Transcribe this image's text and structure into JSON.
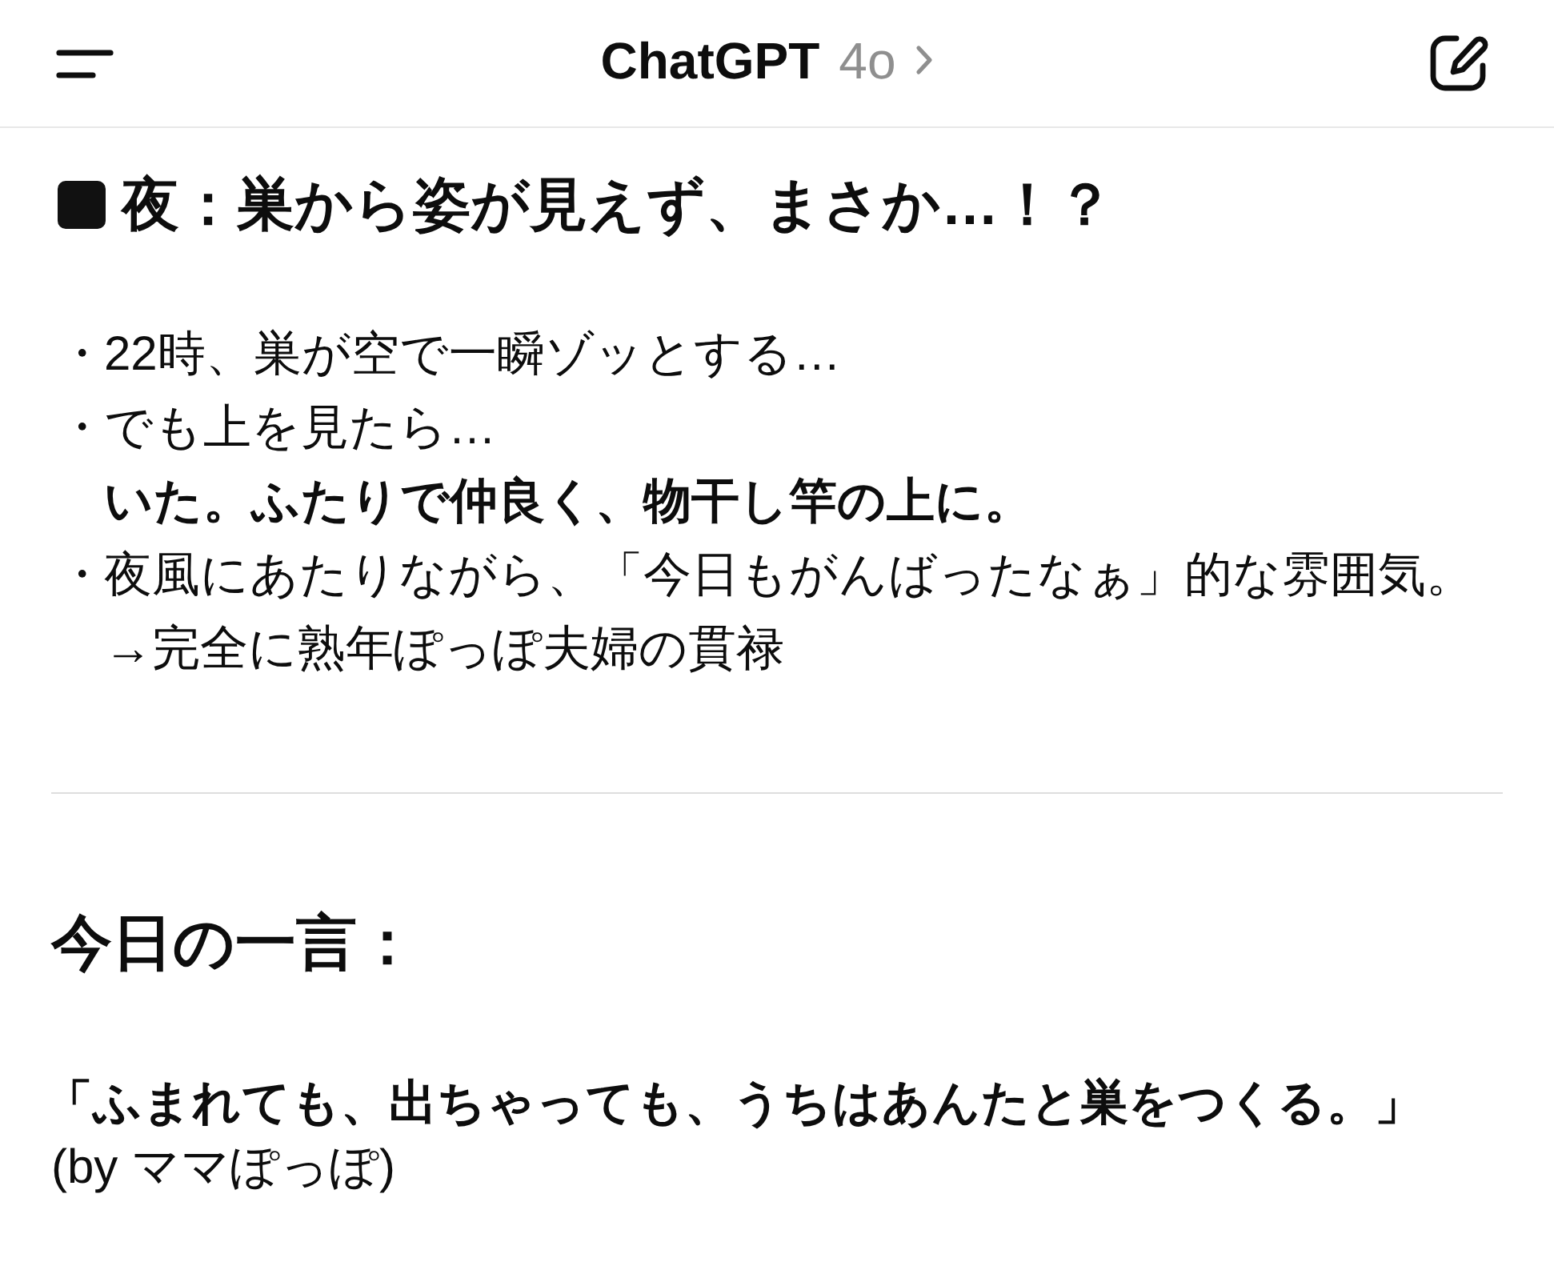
{
  "header": {
    "title": "ChatGPT",
    "model": "4o"
  },
  "section": {
    "heading": "夜：巣から姿が見えず、まさか…！？",
    "lines": [
      {
        "bullet": "・",
        "text": "22時、巣が空で一瞬ゾッとする…",
        "bold": false
      },
      {
        "bullet": "・",
        "text": "でも上を見たら…",
        "bold": false
      },
      {
        "text": "いた。ふたりで仲良く、物干し竿の上に。",
        "bold": true
      },
      {
        "bullet": "・",
        "text": "夜風にあたりながら、「今日もがんばったなぁ」的な雰囲気。",
        "bold": false
      },
      {
        "text": "→完全に熟年ぽっぽ夫婦の貫禄",
        "bold": false
      }
    ]
  },
  "closing": {
    "heading": "今日の一言：",
    "quote": "「ふまれても、出ちゃっても、うちはあんたと巣をつくる。」",
    "attribution": "(by ママぽっぽ)"
  }
}
